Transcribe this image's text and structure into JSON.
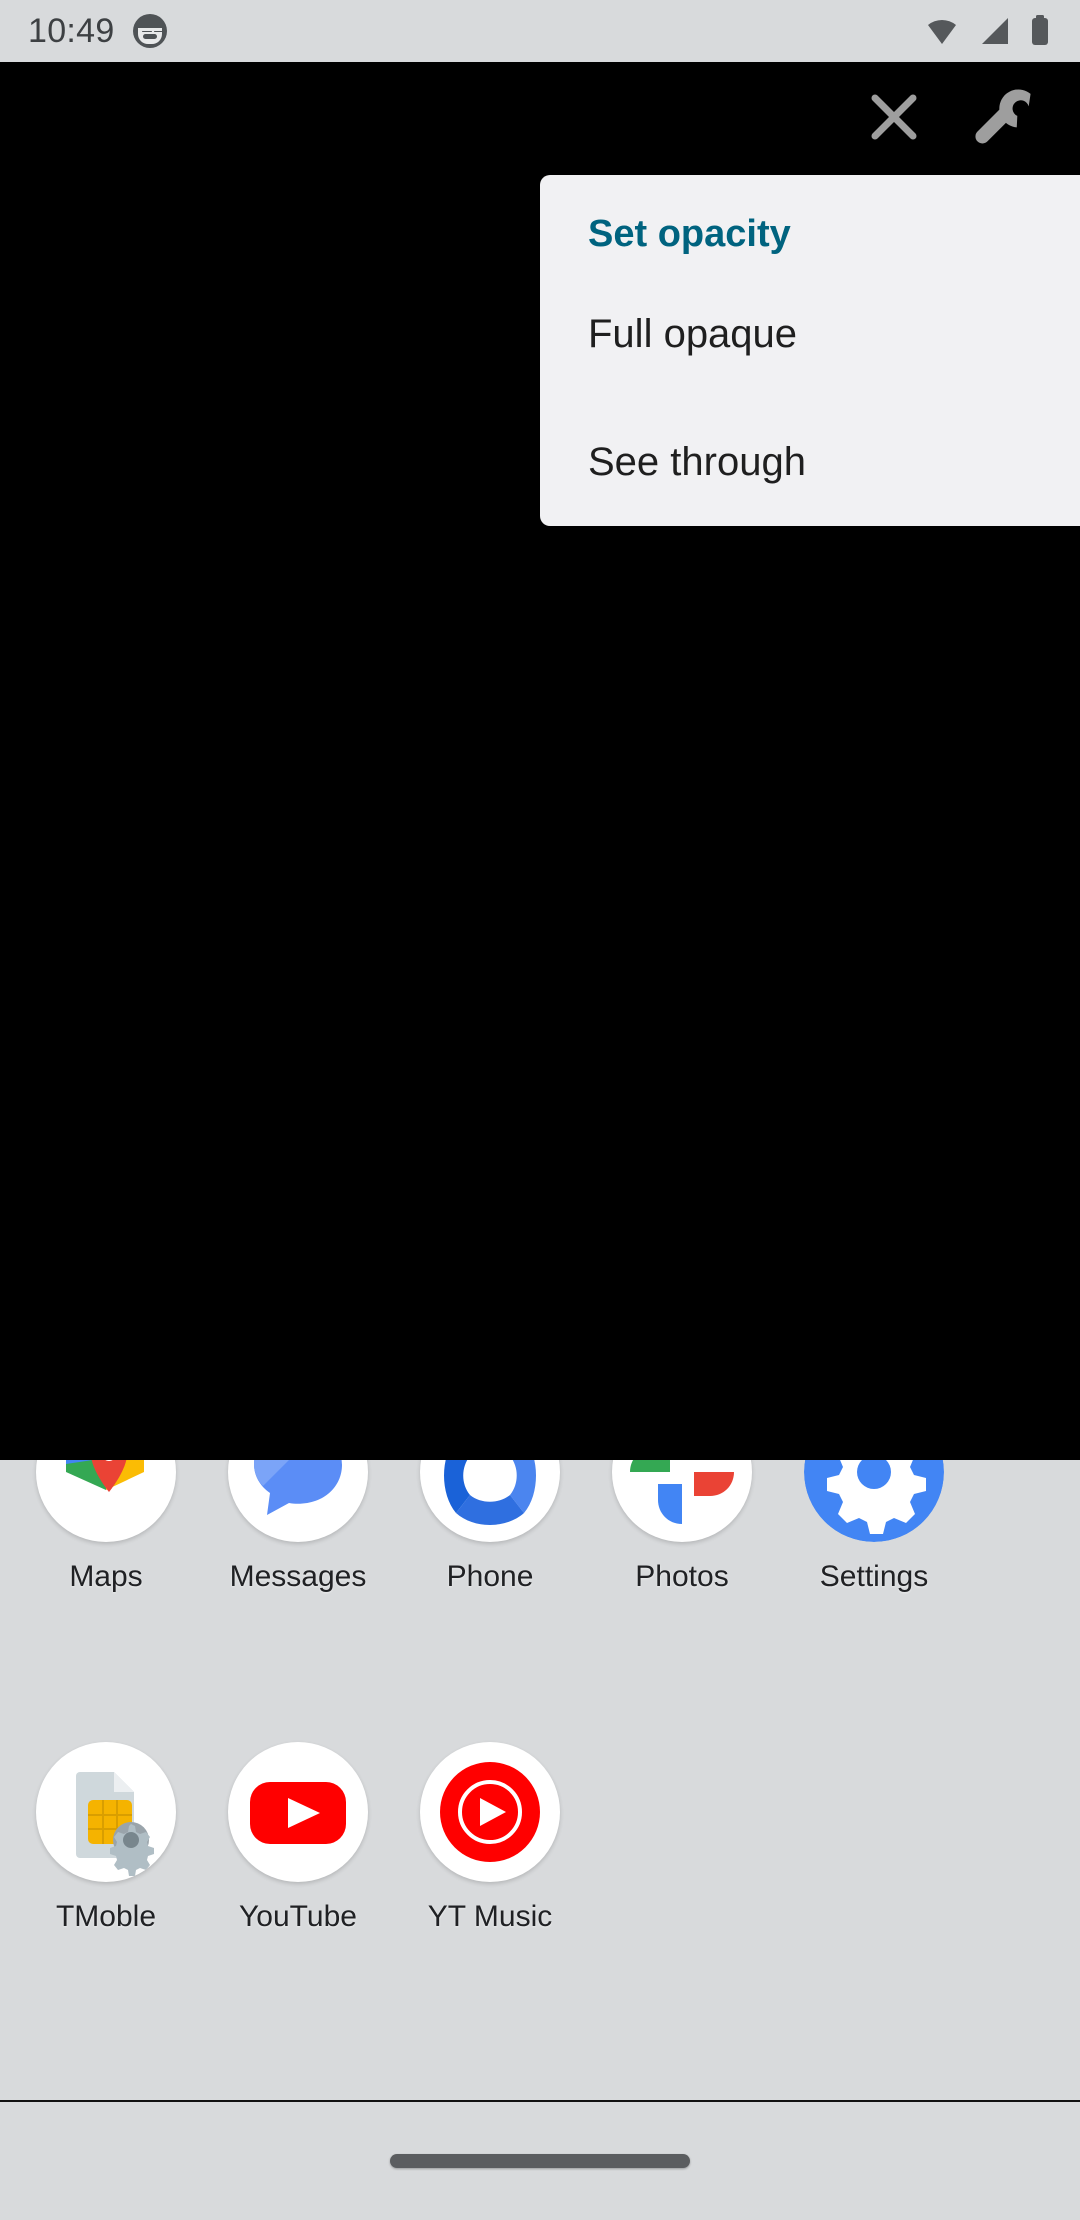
{
  "status_bar": {
    "time": "10:49",
    "notification_icon": "cat-face-notification-icon",
    "wifi_icon": "wifi-icon",
    "signal_icon": "cellular-signal-icon",
    "battery_icon": "battery-full-icon",
    "text_color": "#3d4043",
    "background": "#d8dadc"
  },
  "overlay_window": {
    "background": "#000000",
    "toolbar": {
      "close_icon": "close-x-icon",
      "settings_icon": "wrench-icon"
    }
  },
  "opacity_menu": {
    "background": "#f1f1f3",
    "header_color": "#00637f",
    "header": "Set opacity",
    "items": [
      {
        "label": "Full opaque"
      },
      {
        "label": "See through"
      }
    ]
  },
  "home_screen": {
    "background": "#d8dadc",
    "label_color": "#202124",
    "rows": [
      {
        "apps": [
          {
            "label": "Maps",
            "icon": "google-maps-icon"
          },
          {
            "label": "Messages",
            "icon": "google-messages-icon"
          },
          {
            "label": "Phone",
            "icon": "google-phone-icon"
          },
          {
            "label": "Photos",
            "icon": "google-photos-icon"
          },
          {
            "label": "Settings",
            "icon": "android-settings-icon"
          }
        ]
      },
      {
        "apps": [
          {
            "label": "TMoble",
            "icon": "sim-card-settings-icon"
          },
          {
            "label": "YouTube",
            "icon": "youtube-icon"
          },
          {
            "label": "YT Music",
            "icon": "youtube-music-icon"
          }
        ]
      }
    ]
  },
  "nav_bar": {
    "home_pill": "home-gesture-pill",
    "background": "#d8dadc"
  }
}
